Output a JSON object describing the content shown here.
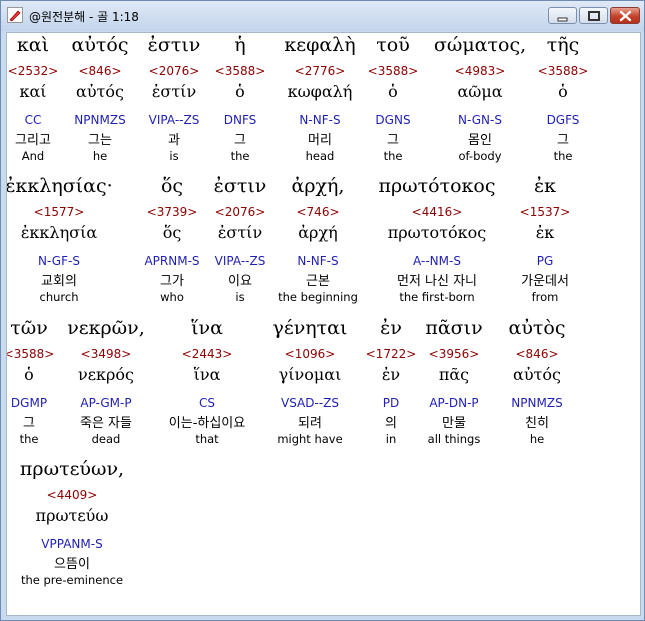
{
  "window": {
    "title": "@원전분해 - 골 1:18",
    "icons": [
      "app-pen-icon",
      "minimize-icon",
      "maximize-icon",
      "close-icon"
    ]
  },
  "rows": [
    [
      {
        "greek": "καὶ",
        "strong": "<2532>",
        "lemma": "καί",
        "morph": "CC",
        "korean": "그리고",
        "english": "And"
      },
      {
        "greek": "αὐτός",
        "strong": "<846>",
        "lemma": "αὐτός",
        "morph": "NPNMZS",
        "korean": "그는",
        "english": "he"
      },
      {
        "greek": "ἐστιν",
        "strong": "<2076>",
        "lemma": "ἐστίν",
        "morph": "VIPA--ZS",
        "korean": "과",
        "english": "is"
      },
      {
        "greek": "ἡ",
        "strong": "<3588>",
        "lemma": "ὁ",
        "morph": "DNFS",
        "korean": "그",
        "english": "the"
      },
      {
        "greek": "κεφαλὴ",
        "strong": "<2776>",
        "lemma": "κωφαλή",
        "morph": "N-NF-S",
        "korean": "머리",
        "english": "head"
      },
      {
        "greek": "τοῦ",
        "strong": "<3588>",
        "lemma": "ὁ",
        "morph": "DGNS",
        "korean": "그",
        "english": "the"
      },
      {
        "greek": "σώματος,",
        "strong": "<4983>",
        "lemma": "αῶμα",
        "morph": "N-GN-S",
        "korean": "몸인",
        "english": "of-body"
      },
      {
        "greek": "τῆς",
        "strong": "<3588>",
        "lemma": "ὁ",
        "morph": "DGFS",
        "korean": "그",
        "english": "the"
      }
    ],
    [
      {
        "greek": "ἐκκλησίας·",
        "strong": "<1577>",
        "lemma": "ἐκκλησία",
        "morph": "N-GF-S",
        "korean": "교회의",
        "english": "church"
      },
      {
        "greek": "ὅς",
        "strong": "<3739>",
        "lemma": "ὅς",
        "morph": "APRNM-S",
        "korean": "그가",
        "english": "who"
      },
      {
        "greek": "ἐστιν",
        "strong": "<2076>",
        "lemma": "ἐστίν",
        "morph": "VIPA--ZS",
        "korean": "이요",
        "english": "is"
      },
      {
        "greek": "ἀρχή,",
        "strong": "<746>",
        "lemma": "ἀρχή",
        "morph": "N-NF-S",
        "korean": "근본",
        "english": "the beginning"
      },
      {
        "greek": "πρωτότοκος",
        "strong": "<4416>",
        "lemma": "πρωτοτόκος",
        "morph": "A--NM-S",
        "korean": "먼저 나신 자니",
        "english": "the first-born"
      },
      {
        "greek": "ἐκ",
        "strong": "<1537>",
        "lemma": "ἐκ",
        "morph": "PG",
        "korean": "가운데서",
        "english": "from"
      }
    ],
    [
      {
        "greek": "τῶν",
        "strong": "<3588>",
        "lemma": "ὁ",
        "morph": "DGMP",
        "korean": "그",
        "english": "the"
      },
      {
        "greek": "νεκρῶν,",
        "strong": "<3498>",
        "lemma": "νεκρός",
        "morph": "AP-GM-P",
        "korean": "죽은 자들",
        "english": "dead"
      },
      {
        "greek": "ἵνα",
        "strong": "<2443>",
        "lemma": "ἵνα",
        "morph": "CS",
        "korean": "이는-하십이요",
        "english": "that"
      },
      {
        "greek": "γένηται",
        "strong": "<1096>",
        "lemma": "γίνομαι",
        "morph": "VSAD--ZS",
        "korean": "되려",
        "english": "might have"
      },
      {
        "greek": "ἐν",
        "strong": "<1722>",
        "lemma": "ἐν",
        "morph": "PD",
        "korean": "의",
        "english": "in"
      },
      {
        "greek": "πᾶσιν",
        "strong": "<3956>",
        "lemma": "πᾶς",
        "morph": "AP-DN-P",
        "korean": "만물",
        "english": "all things"
      },
      {
        "greek": "αὐτὸς",
        "strong": "<846>",
        "lemma": "αὐτός",
        "morph": "NPNMZS",
        "korean": "친히",
        "english": "he"
      }
    ],
    [
      {
        "greek": "πρωτεύων,",
        "strong": "<4409>",
        "lemma": "πρωτεύω",
        "morph": "VPPANM-S",
        "korean": "으뜸이",
        "english": "the pre-eminence"
      }
    ]
  ]
}
